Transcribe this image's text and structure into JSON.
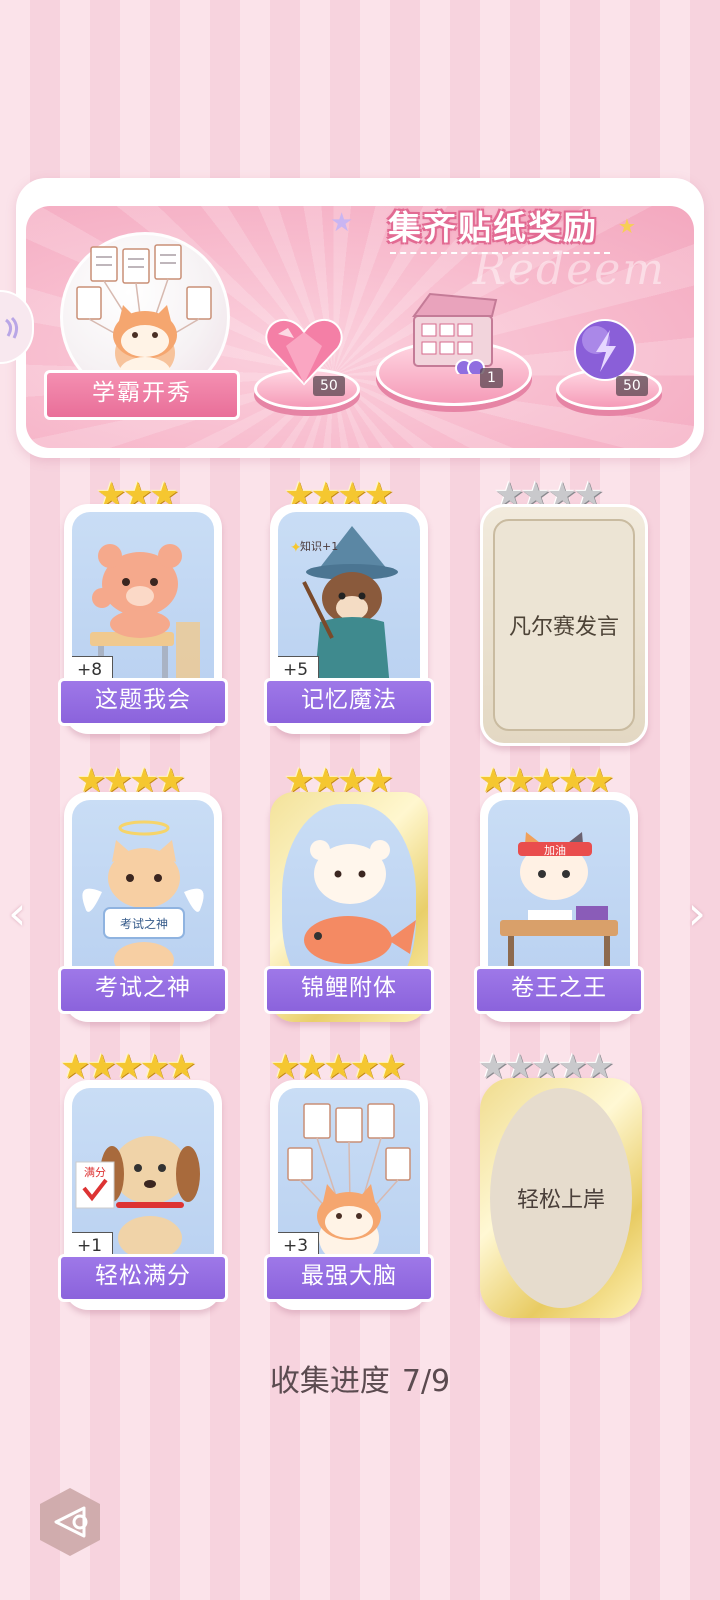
{
  "banner": {
    "title": "集齐贴纸奖励",
    "watermark": "Redeem",
    "featured_label": "学霸开秀",
    "rewards": [
      {
        "icon": "pink-heart-gem-icon",
        "count": "50"
      },
      {
        "icon": "gift-box-icon",
        "count": "1"
      },
      {
        "icon": "purple-energy-orb-icon",
        "count": "50"
      }
    ]
  },
  "stickers": [
    {
      "label": "这题我会",
      "count": "+8",
      "stars_filled": 3,
      "stars_total": 3,
      "collected": true
    },
    {
      "label": "记忆魔法",
      "count": "+5",
      "stars_filled": 4,
      "stars_total": 4,
      "collected": true
    },
    {
      "label": "凡尔赛发言",
      "stars_filled": 0,
      "stars_total": 4,
      "collected": false
    },
    {
      "label": "考试之神",
      "stars_filled": 4,
      "stars_total": 4,
      "collected": true
    },
    {
      "label": "锦鲤附体",
      "stars_filled": 4,
      "stars_total": 4,
      "collected": true
    },
    {
      "label": "卷王之王",
      "stars_filled": 5,
      "stars_total": 5,
      "collected": true
    },
    {
      "label": "轻松满分",
      "count": "+1",
      "stars_filled": 5,
      "stars_total": 5,
      "collected": true
    },
    {
      "label": "最强大脑",
      "count": "+3",
      "stars_filled": 5,
      "stars_total": 5,
      "collected": true
    },
    {
      "label": "轻松上岸",
      "stars_filled": 0,
      "stars_total": 5,
      "collected": false
    }
  ],
  "art_text": {
    "wizard_tag": "知识+1",
    "angel_sign": "考试之神",
    "headband": "加油",
    "dog_sign": "满分"
  },
  "progress": {
    "label": "收集进度",
    "value": "7/9"
  },
  "colors": {
    "accent_purple": "#8b63dc",
    "pink": "#f48fb1",
    "gold_star": "#f5c730"
  }
}
